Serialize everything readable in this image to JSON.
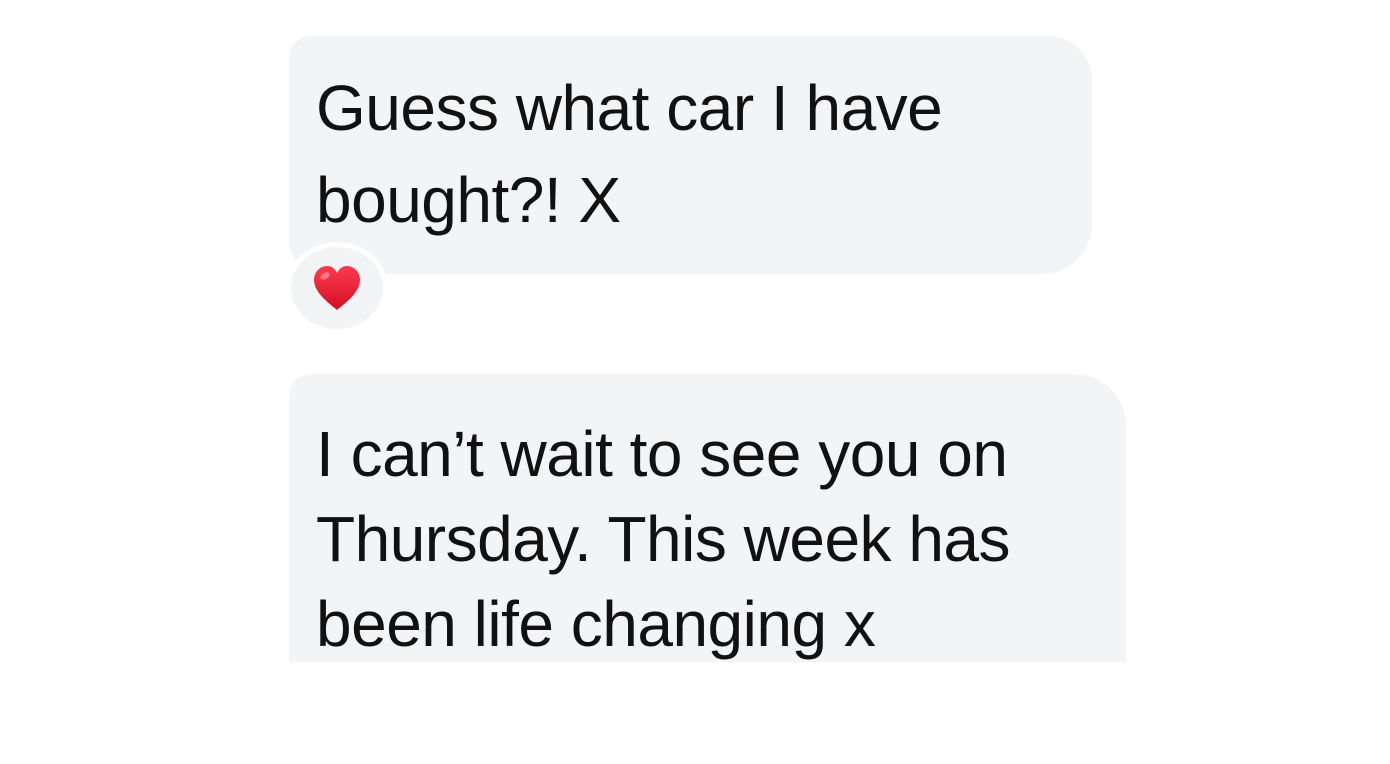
{
  "messages": [
    {
      "text": "Guess what car I have bought?! X",
      "reaction": "heart-icon"
    },
    {
      "text": "I can’t wait to see you on Thursday. This week has been life changing x"
    }
  ],
  "colors": {
    "bubble_background": "#f3f4f6",
    "text": "#111111",
    "heart": "#e0102b",
    "page_background": "#ffffff"
  }
}
